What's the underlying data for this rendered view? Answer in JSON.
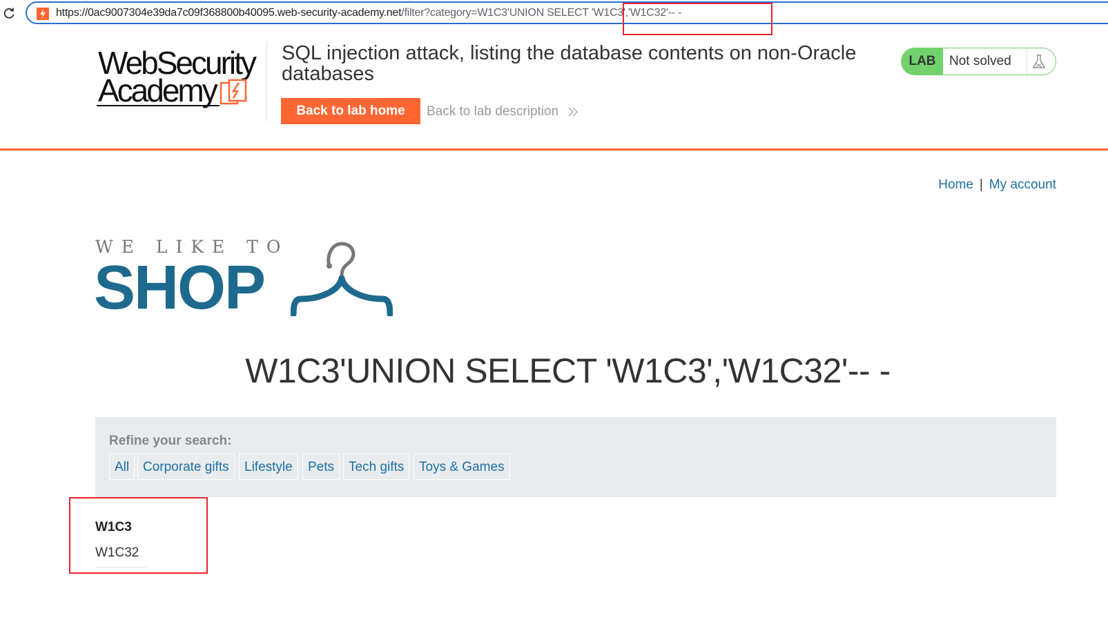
{
  "browser": {
    "url_host": "https://0ac9007304e39da7c09f368800b40095.web-security-academy.net",
    "url_rest": "/filter?category=W1C3'UNION SELECT 'W1C3','W1C32'-- -"
  },
  "academy": {
    "logo_line1": "WebSecurity",
    "logo_line2": "Academy",
    "lab_title": "SQL injection attack, listing the database contents on non-Oracle databases",
    "back_home_label": "Back to lab home",
    "back_description_label": "Back to lab description",
    "lab_badge": "LAB",
    "lab_status": "Not solved"
  },
  "nav": {
    "home": "Home",
    "separator": "|",
    "my_account": "My account"
  },
  "shop_logo": {
    "tagline": "WE LIKE TO",
    "word": "SHOP"
  },
  "page_heading": "W1C3'UNION SELECT 'W1C3','W1C32'-- -",
  "filter": {
    "label": "Refine your search:",
    "categories": [
      "All",
      "Corporate gifts",
      "Lifestyle",
      "Pets",
      "Tech gifts",
      "Toys & Games"
    ]
  },
  "results": {
    "title": "W1C3",
    "value": "W1C32"
  },
  "colors": {
    "accent_orange": "#ff6633",
    "link_blue": "#1d6fa5",
    "shop_blue": "#1e6a8e",
    "lab_green": "#70d16d",
    "annotation_red": "#e8242b"
  }
}
